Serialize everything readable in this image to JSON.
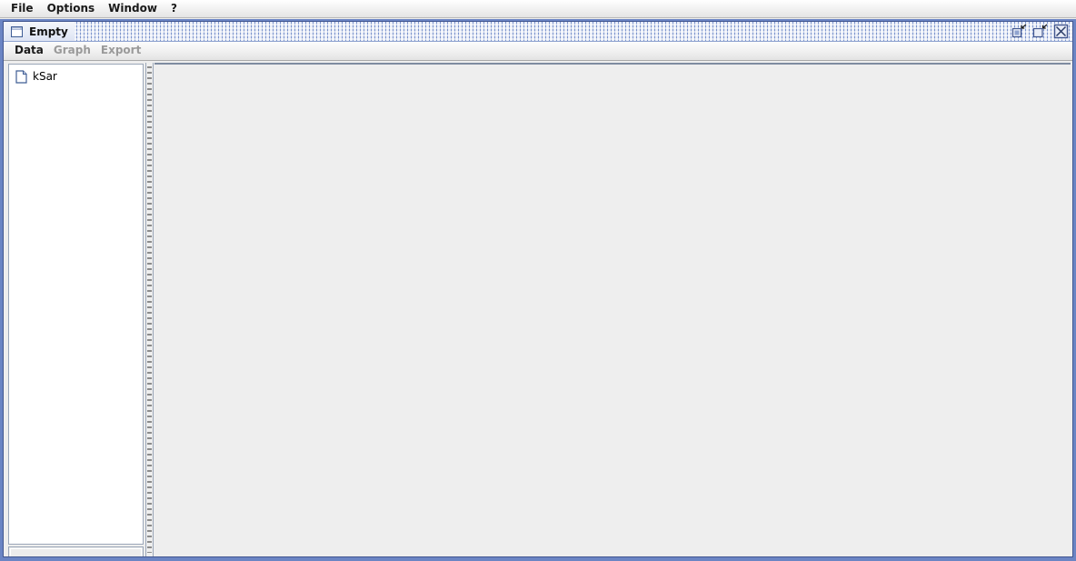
{
  "app": {
    "menubar": {
      "items": [
        {
          "label": "File",
          "name": "menu-file"
        },
        {
          "label": "Options",
          "name": "menu-options"
        },
        {
          "label": "Window",
          "name": "menu-window"
        },
        {
          "label": "?",
          "name": "menu-help"
        }
      ]
    }
  },
  "internal_frame": {
    "title": "Empty",
    "window_icon": "window-icon",
    "controls": [
      {
        "name": "minimize-button",
        "icon": "minimize-icon",
        "tooltip": "Minimize"
      },
      {
        "name": "maximize-button",
        "icon": "maximize-icon",
        "tooltip": "Maximize"
      },
      {
        "name": "close-button",
        "icon": "close-icon",
        "tooltip": "Close"
      }
    ],
    "menubar": {
      "items": [
        {
          "label": "Data",
          "name": "frame-menu-data",
          "enabled": true
        },
        {
          "label": "Graph",
          "name": "frame-menu-graph",
          "enabled": false
        },
        {
          "label": "Export",
          "name": "frame-menu-export",
          "enabled": false
        }
      ]
    },
    "tree": {
      "items": [
        {
          "label": "kSar",
          "icon": "document-icon"
        }
      ]
    },
    "main_panel": {
      "content": ""
    }
  },
  "colors": {
    "desktop_blue": "#6b85c4",
    "frame_border": "#41568f",
    "panel_bg": "#eeeeee",
    "tree_bg": "#ffffff",
    "menu_disabled": "#9a9a9a",
    "menu_enabled": "#1a1a1a",
    "titlebar_pattern": "#7a93cc",
    "icon_blue": "#3f5d95"
  }
}
